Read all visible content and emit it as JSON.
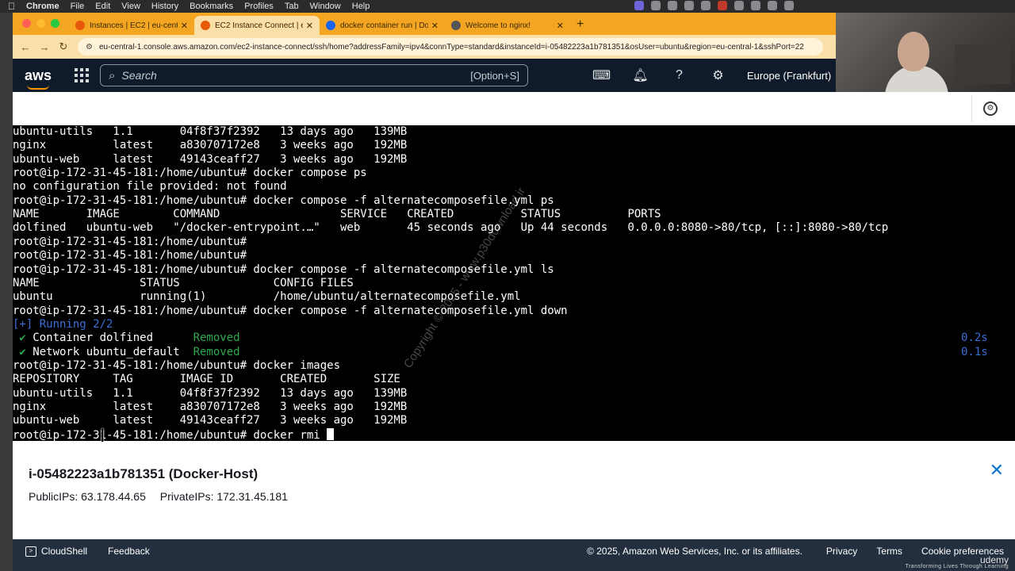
{
  "menubar": {
    "app": "Chrome",
    "items": [
      "File",
      "Edit",
      "View",
      "History",
      "Bookmarks",
      "Profiles",
      "Tab",
      "Window",
      "Help"
    ]
  },
  "browser": {
    "tabs": [
      {
        "label": "Instances | EC2 | eu-central-1",
        "fav_color": "#e8590c",
        "active": false
      },
      {
        "label": "EC2 Instance Connect | eu-ce",
        "fav_color": "#e8590c",
        "active": true
      },
      {
        "label": "docker container run | Docker",
        "fav_color": "#1d63ed",
        "active": false
      },
      {
        "label": "Welcome to nginx!",
        "fav_color": "#555555",
        "active": false
      }
    ],
    "new_tab_label": "+",
    "url": "eu-central-1.console.aws.amazon.com/ec2-instance-connect/ssh/home?addressFamily=ipv4&connType=standard&instanceId=i-05482223a1b781351&osUser=ubuntu&region=eu-central-1&sshPort=22"
  },
  "aws_header": {
    "logo": "aws",
    "search_placeholder": "Search",
    "search_shortcut": "[Option+S]",
    "region": "Europe (Frankfurt)"
  },
  "terminal": {
    "lines": [
      {
        "text": "ubuntu-utils   1.1       04f8f37f2392   13 days ago   139MB",
        "style": "plain"
      },
      {
        "text": "nginx          latest    a830707172e8   3 weeks ago   192MB",
        "style": "plain"
      },
      {
        "text": "ubuntu-web     latest    49143ceaff27   3 weeks ago   192MB",
        "style": "plain"
      },
      {
        "text": "root@ip-172-31-45-181:/home/ubuntu# docker compose ps",
        "style": "plain"
      },
      {
        "text": "no configuration file provided: not found",
        "style": "plain"
      },
      {
        "text": "root@ip-172-31-45-181:/home/ubuntu# docker compose -f alternatecomposefile.yml ps",
        "style": "plain"
      },
      {
        "text": "NAME       IMAGE        COMMAND                  SERVICE   CREATED          STATUS          PORTS",
        "style": "plain"
      },
      {
        "text": "dolfined   ubuntu-web   \"/docker-entrypoint.…\"   web       45 seconds ago   Up 44 seconds   0.0.0.0:8080->80/tcp, [::]:8080->80/tcp",
        "style": "plain"
      },
      {
        "text": "root@ip-172-31-45-181:/home/ubuntu#",
        "style": "plain"
      },
      {
        "text": "root@ip-172-31-45-181:/home/ubuntu#",
        "style": "plain"
      },
      {
        "text": "root@ip-172-31-45-181:/home/ubuntu# docker compose -f alternatecomposefile.yml ls",
        "style": "plain"
      },
      {
        "text": "NAME               STATUS              CONFIG FILES",
        "style": "plain"
      },
      {
        "text": "ubuntu             running(1)          /home/ubuntu/alternatecomposefile.yml",
        "style": "plain"
      },
      {
        "text": "root@ip-172-31-45-181:/home/ubuntu# docker compose -f alternatecomposefile.yml down",
        "style": "plain"
      },
      {
        "text": "[+] Running 2/2",
        "style": "blue"
      },
      {
        "check": " ✔",
        "text": " Container dolfined      ",
        "removed": "Removed",
        "time": "0.2s",
        "style": "status"
      },
      {
        "check": " ✔",
        "text": " Network ubuntu_default  ",
        "removed": "Removed",
        "time": "0.1s",
        "style": "status"
      },
      {
        "text": "root@ip-172-31-45-181:/home/ubuntu# docker images",
        "style": "plain"
      },
      {
        "text": "REPOSITORY     TAG       IMAGE ID       CREATED       SIZE",
        "style": "plain"
      },
      {
        "text": "ubuntu-utils   1.1       04f8f37f2392   13 days ago   139MB",
        "style": "plain"
      },
      {
        "text": "nginx          latest    a830707172e8   3 weeks ago   192MB",
        "style": "plain"
      },
      {
        "text": "ubuntu-web     latest    49143ceaff27   3 weeks ago   192MB",
        "style": "plain"
      },
      {
        "text": "root@ip-172-31-45-181:/home/ubuntu# docker rmi ",
        "style": "prompt"
      }
    ],
    "watermark": "Copyright © 2025 - www.p30download.ir"
  },
  "instance": {
    "title": "i-05482223a1b781351 (Docker-Host)",
    "public_ips": "PublicIPs: 63.178.44.65",
    "private_ips": "PrivateIPs: 172.31.45.181"
  },
  "footer": {
    "cloudshell": "CloudShell",
    "feedback": "Feedback",
    "copyright": "© 2025, Amazon Web Services, Inc. or its affiliates.",
    "links": [
      "Privacy",
      "Terms",
      "Cookie preferences"
    ]
  },
  "overlay": {
    "brand": "udemy",
    "tagline": "Transforming Lives Through Learning"
  }
}
